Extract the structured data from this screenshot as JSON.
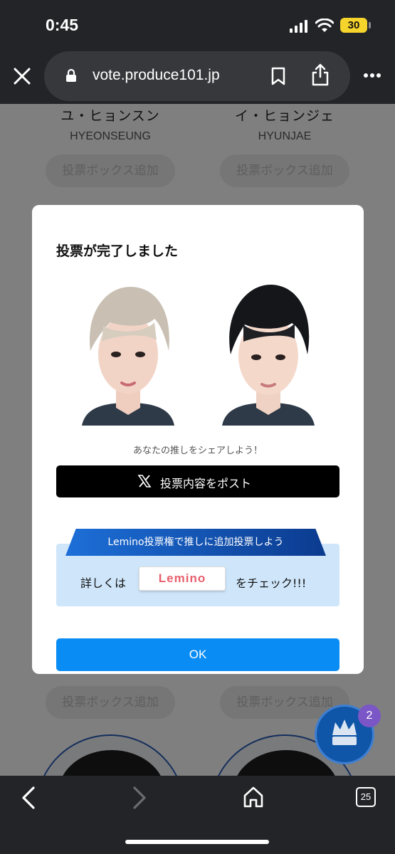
{
  "status": {
    "time": "0:45",
    "battery": "30"
  },
  "browser": {
    "url": "vote.produce101.jp",
    "tab_count": "25"
  },
  "page": {
    "candidates": [
      {
        "name_jp": "ユ・ヒョンスン",
        "name_en": "HYEONSEUNG"
      },
      {
        "name_jp": "イ・ヒョンジェ",
        "name_en": "HYUNJAE"
      }
    ],
    "add_vote_label": "投票ボックス追加",
    "vote_box_count": "2"
  },
  "modal": {
    "title": "投票が完了しました",
    "share_caption": "あなたの推しをシェアしよう！",
    "post_button": "投票内容をポスト",
    "lemino_banner": "Lemino投票権で推しに追加投票しよう",
    "detail_prefix": "詳しくは",
    "lemino_logo": "Lemino",
    "detail_suffix": "をチェック!!!",
    "ok_button": "OK"
  },
  "colors": {
    "accent": "#0a8cf5",
    "lemino_bg": "#cfe6fa",
    "ribbon": "#1d6fd8",
    "lemino_brand": "#e8606d"
  }
}
